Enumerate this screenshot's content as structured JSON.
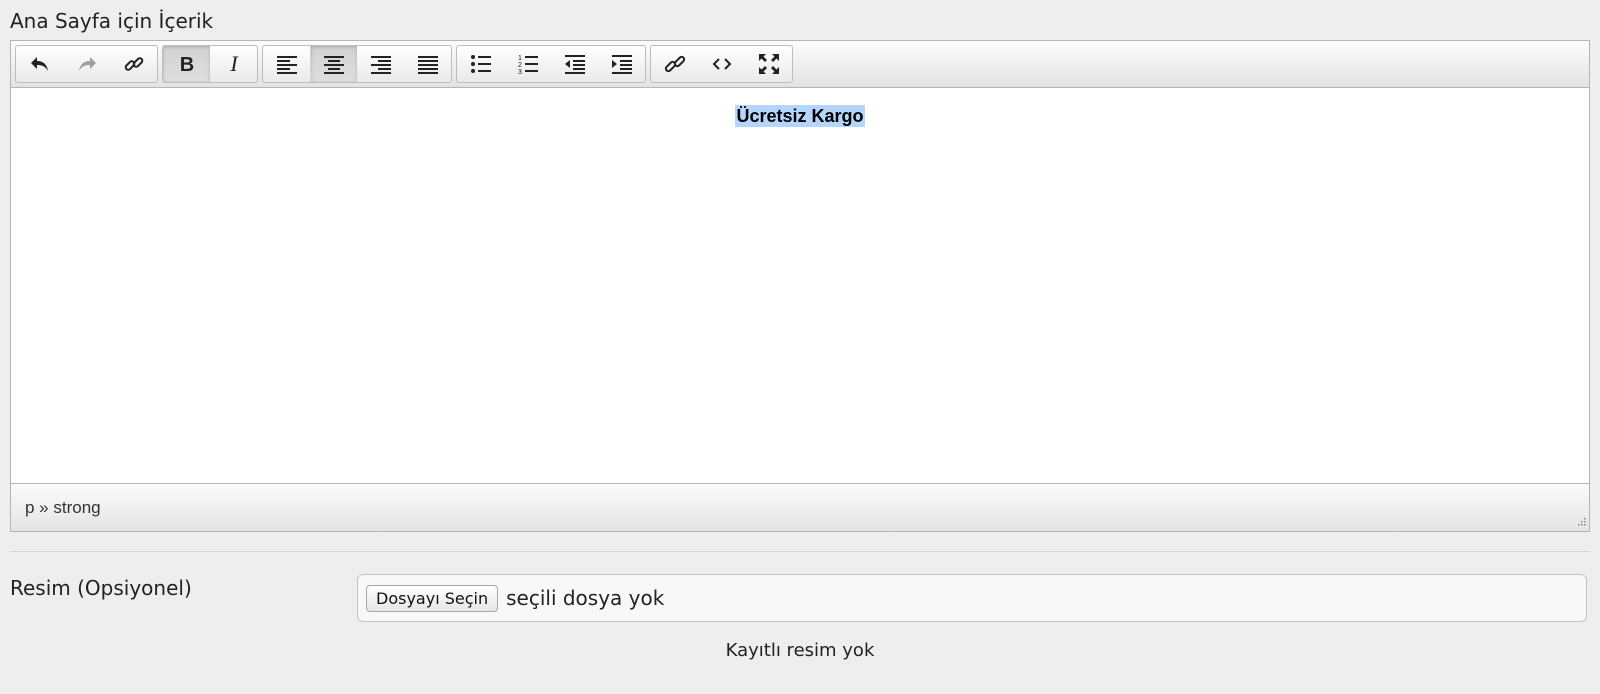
{
  "content_field": {
    "label": "Ana Sayfa için İçerik",
    "toolbar": {
      "groups": [
        [
          "undo-icon",
          "redo-icon",
          "unlink-icon"
        ],
        [
          "bold-icon",
          "italic-icon"
        ],
        [
          "align-left-icon",
          "align-center-icon",
          "align-right-icon",
          "align-justify-icon"
        ],
        [
          "bullet-list-icon",
          "numbered-list-icon",
          "outdent-icon",
          "indent-icon"
        ],
        [
          "link-icon",
          "source-code-icon",
          "fullscreen-icon"
        ]
      ],
      "active": [
        "bold-icon",
        "align-center-icon"
      ],
      "disabled": [
        "redo-icon"
      ]
    },
    "body_text": "Ücretsiz Kargo",
    "status_path": "p » strong"
  },
  "image_field": {
    "label": "Resim (Opsiyonel)",
    "choose_button": "Dosyayı Seçin",
    "file_status": "seçili dosya yok",
    "saved_note": "Kayıtlı resim yok"
  },
  "colors": {
    "selection": "#b4d5fe",
    "background": "#eeeeee"
  }
}
